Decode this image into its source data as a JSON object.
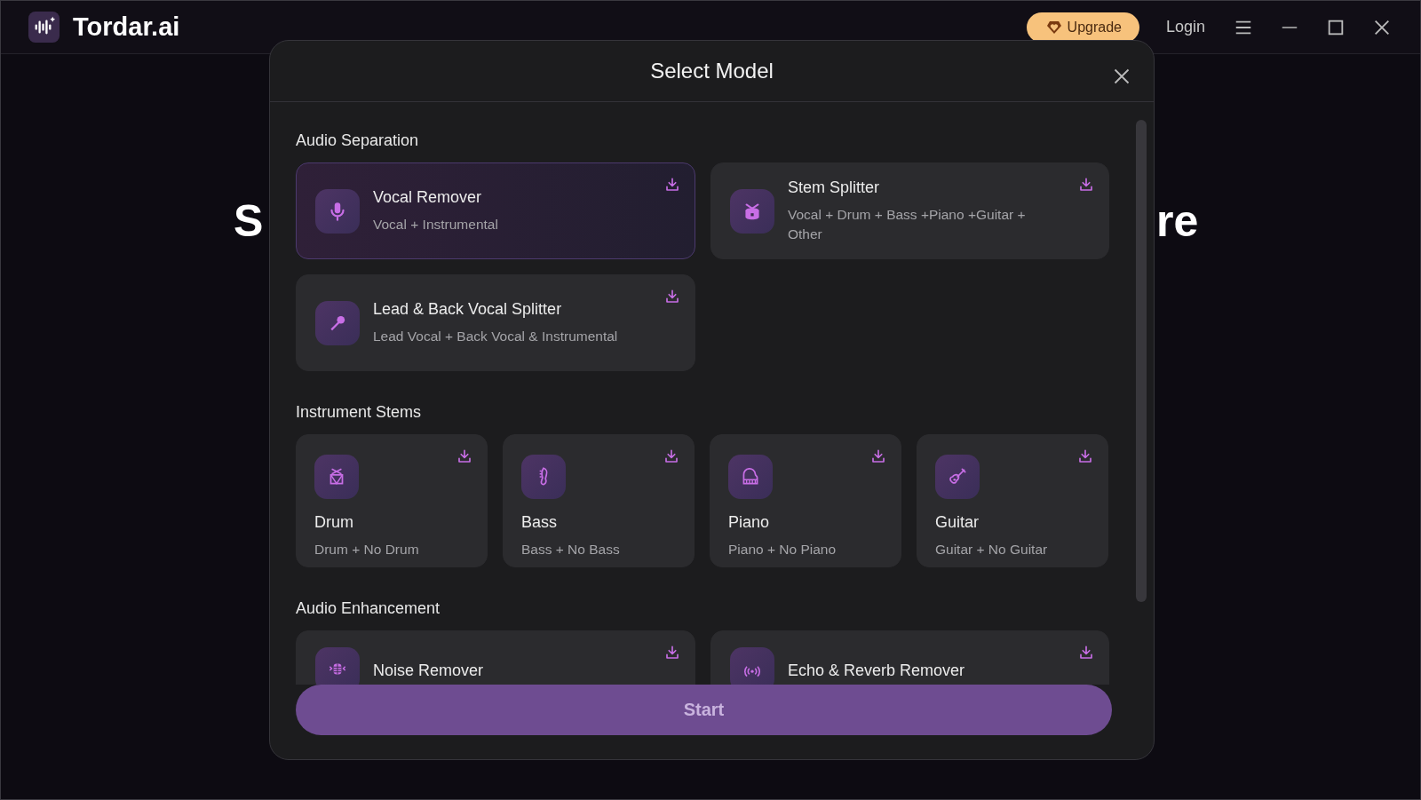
{
  "app": {
    "title": "Tordar.ai",
    "upgrade": "Upgrade",
    "login": "Login"
  },
  "background": {
    "heading_left": "S",
    "heading_right": "re"
  },
  "dialog": {
    "title": "Select Model",
    "sections": [
      {
        "title": "Audio Separation",
        "kind": "wide",
        "models": [
          {
            "name": "Vocal Remover",
            "description": "Vocal + Instrumental",
            "selected": true
          },
          {
            "name": "Stem Splitter",
            "description": "Vocal + Drum + Bass +Piano +Guitar + Other",
            "selected": false
          },
          {
            "name": "Lead & Back Vocal Splitter",
            "description": "Lead Vocal + Back Vocal & Instrumental",
            "selected": false
          }
        ]
      },
      {
        "title": "Instrument Stems",
        "kind": "tile",
        "models": [
          {
            "name": "Drum",
            "description": "Drum + No Drum",
            "selected": false
          },
          {
            "name": "Bass",
            "description": "Bass + No Bass",
            "selected": false
          },
          {
            "name": "Piano",
            "description": "Piano + No Piano",
            "selected": false
          },
          {
            "name": "Guitar",
            "description": "Guitar + No Guitar",
            "selected": false
          }
        ]
      },
      {
        "title": "Audio Enhancement",
        "kind": "wide",
        "models": [
          {
            "name": "Noise Remover",
            "selected": false
          },
          {
            "name": "Echo & Reverb Remover",
            "selected": false
          }
        ]
      }
    ],
    "start_button": "Start"
  }
}
